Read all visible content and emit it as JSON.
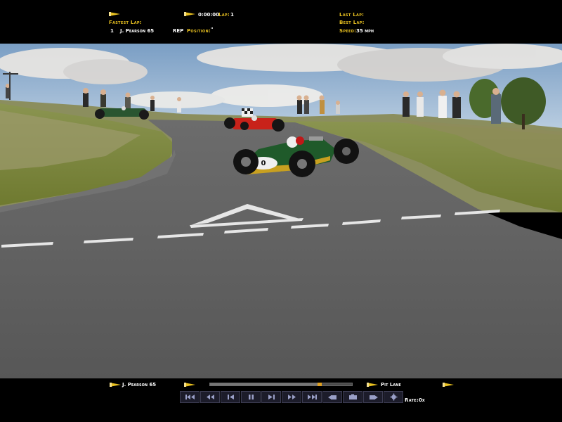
{
  "hud_top": {
    "time": "0:00:00",
    "lap_label": "Lap:",
    "lap_value": "1",
    "fastest_lap_label": "Fastest Lap:",
    "position_number": "1",
    "driver": "J. Pearson 65",
    "rep": "REP",
    "position_label": "Position:",
    "position_value": "\"",
    "last_lap_label": "Last Lap:",
    "best_lap_label": "Best Lap:",
    "speed_label": "Speed:",
    "speed_value": "35 mph"
  },
  "hud_bottom": {
    "driver": "J. Pearson 65",
    "pit_lane": "Pit Lane",
    "rate_label": "Rate:",
    "rate_value": "0x",
    "replay_progress": 0.77,
    "transport_buttons": [
      {
        "name": "skip-to-start-icon"
      },
      {
        "name": "rewind-icon"
      },
      {
        "name": "step-back-icon"
      },
      {
        "name": "pause-icon"
      },
      {
        "name": "step-forward-icon"
      },
      {
        "name": "fast-forward-icon"
      },
      {
        "name": "skip-to-end-icon"
      },
      {
        "name": "camera-prev-icon"
      },
      {
        "name": "camera-icon"
      },
      {
        "name": "camera-next-icon"
      },
      {
        "name": "settings-icon"
      }
    ]
  },
  "scene": {
    "player_car_number": "0",
    "colors": {
      "sky": "#8fb2d6",
      "road": "#5a5a5a",
      "grass": "#7c8a3a",
      "player_car": "#1f5a2a",
      "rival_car": "#c8221a",
      "hud_yellow": "#e8c020"
    }
  }
}
